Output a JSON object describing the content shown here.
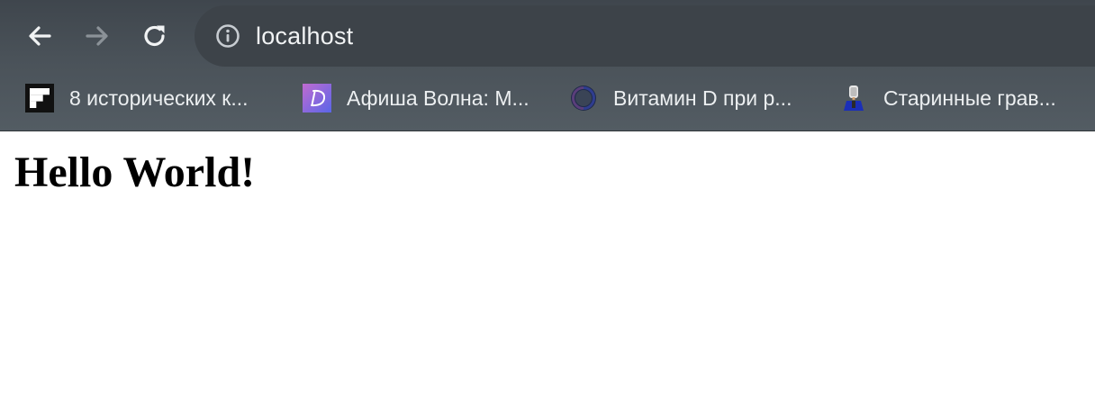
{
  "browser": {
    "address_bar": {
      "url": "localhost",
      "info_icon": "info-icon"
    },
    "nav": {
      "back_icon": "arrow-left-icon",
      "forward_icon": "arrow-right-icon",
      "reload_icon": "reload-icon"
    },
    "bookmarks": [
      {
        "label": "8 исторических к...",
        "icon": "flipboard-icon"
      },
      {
        "label": "Афиша Волна: М...",
        "icon": "afisha-d-icon"
      },
      {
        "label": "Витамин D при р...",
        "icon": "ring-icon"
      },
      {
        "label": "Старинные грав...",
        "icon": "person-icon"
      }
    ]
  },
  "page": {
    "heading": "Hello World!"
  },
  "colors": {
    "chrome_bg": "#4a5259",
    "omnibox_bg": "#3d4349",
    "text_light": "#f1f3f4",
    "page_bg": "#ffffff"
  }
}
